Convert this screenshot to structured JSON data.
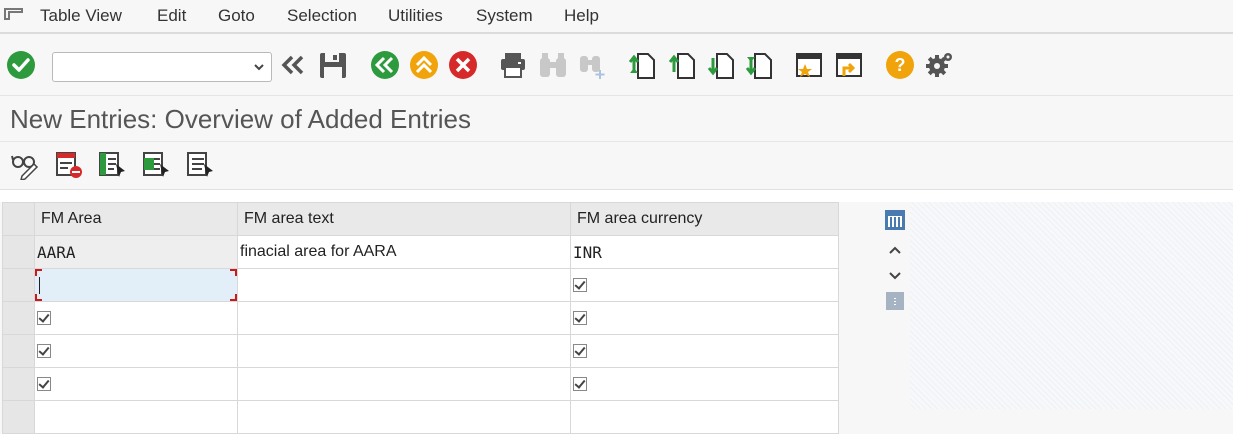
{
  "menubar": {
    "items": [
      "Table View",
      "Edit",
      "Goto",
      "Selection",
      "Utilities",
      "System",
      "Help"
    ]
  },
  "toolbar": {
    "command_value": "",
    "icons": [
      "enter-icon",
      "command-dropdown",
      "back-icon",
      "save-icon",
      "back-green-icon",
      "exit-icon",
      "cancel-icon",
      "print-icon",
      "find-icon",
      "find-next-icon",
      "first-page-icon",
      "previous-page-icon",
      "next-page-icon",
      "last-page-icon",
      "create-session-icon",
      "shortcut-icon",
      "help-icon",
      "settings-icon"
    ]
  },
  "page": {
    "title": "New Entries: Overview of Added Entries"
  },
  "app_toolbar": {
    "icons": [
      "display-change-icon",
      "delete-icon",
      "select-all-icon",
      "select-block-icon",
      "deselect-all-icon"
    ]
  },
  "table": {
    "columns": [
      "FM Area",
      "FM area text",
      "FM area currency"
    ],
    "rows": [
      {
        "fm_area": "AARA",
        "text": "finacial area for AARA",
        "currency": "INR"
      }
    ]
  },
  "colors": {
    "accent_green": "#2e9a3e",
    "accent_orange": "#f0a30a",
    "accent_red": "#d62a2a",
    "focus_red": "#cc1a1a"
  }
}
